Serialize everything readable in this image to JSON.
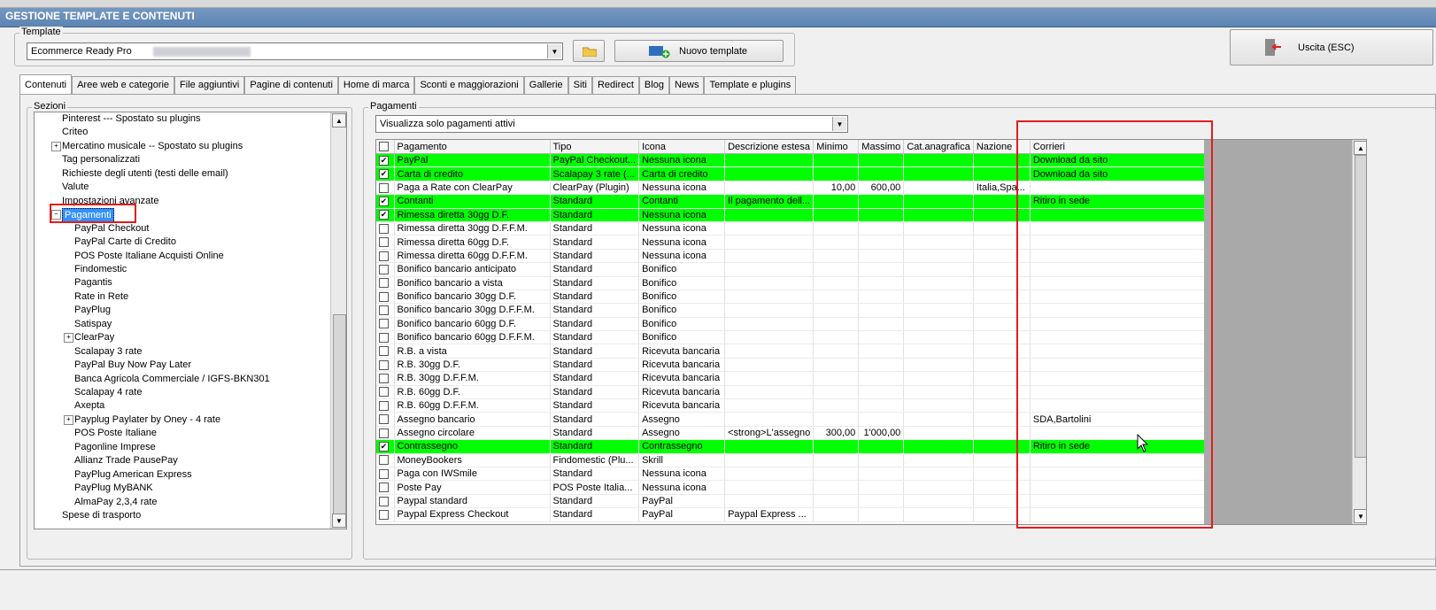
{
  "window": {
    "title": "GESTIONE TEMPLATE E CONTENUTI"
  },
  "template": {
    "group_label": "Template",
    "selected": "Ecommerce Ready Pro",
    "new_template_label": "Nuovo template",
    "exit_label": "Uscita (ESC)"
  },
  "tabs": [
    "Contenuti",
    "Aree web e categorie",
    "File aggiuntivi",
    "Pagine di contenuti",
    "Home di marca",
    "Sconti e maggiorazioni",
    "Gallerie",
    "Siti",
    "Redirect",
    "Blog",
    "News",
    "Template e plugins"
  ],
  "sections": {
    "label": "Sezioni",
    "items": [
      {
        "label": "Pinterest --- Spostato su plugins",
        "level": 0,
        "expander": ""
      },
      {
        "label": "Criteo",
        "level": 0,
        "expander": ""
      },
      {
        "label": "Mercatino musicale -- Spostato su plugins",
        "level": 0,
        "expander": "+"
      },
      {
        "label": "Tag personalizzati",
        "level": 0,
        "expander": ""
      },
      {
        "label": "Richieste degli utenti (testi delle email)",
        "level": 0,
        "expander": ""
      },
      {
        "label": "Valute",
        "level": 0,
        "expander": ""
      },
      {
        "label": "Impostazioni avanzate",
        "level": 0,
        "expander": ""
      },
      {
        "label": "Pagamenti",
        "level": 0,
        "expander": "-",
        "selected": true
      },
      {
        "label": "PayPal Checkout",
        "level": 1,
        "expander": ""
      },
      {
        "label": "PayPal Carte di Credito",
        "level": 1,
        "expander": ""
      },
      {
        "label": "POS Poste Italiane Acquisti Online",
        "level": 1,
        "expander": ""
      },
      {
        "label": "Findomestic",
        "level": 1,
        "expander": ""
      },
      {
        "label": "Pagantis",
        "level": 1,
        "expander": ""
      },
      {
        "label": "Rate in Rete",
        "level": 1,
        "expander": ""
      },
      {
        "label": "PayPlug",
        "level": 1,
        "expander": ""
      },
      {
        "label": "Satispay",
        "level": 1,
        "expander": ""
      },
      {
        "label": "ClearPay",
        "level": 1,
        "expander": "+"
      },
      {
        "label": "Scalapay 3 rate",
        "level": 1,
        "expander": ""
      },
      {
        "label": "PayPal Buy Now Pay Later",
        "level": 1,
        "expander": ""
      },
      {
        "label": "Banca Agricola Commerciale / IGFS-BKN301",
        "level": 1,
        "expander": ""
      },
      {
        "label": "Scalapay 4 rate",
        "level": 1,
        "expander": ""
      },
      {
        "label": "Axepta",
        "level": 1,
        "expander": ""
      },
      {
        "label": "Payplug Paylater by Oney - 4 rate",
        "level": 1,
        "expander": "+"
      },
      {
        "label": "POS Poste Italiane",
        "level": 1,
        "expander": ""
      },
      {
        "label": "Pagonline Imprese",
        "level": 1,
        "expander": ""
      },
      {
        "label": "Allianz Trade PausePay",
        "level": 1,
        "expander": ""
      },
      {
        "label": "PayPlug American Express",
        "level": 1,
        "expander": ""
      },
      {
        "label": "PayPlug MyBANK",
        "level": 1,
        "expander": ""
      },
      {
        "label": "AlmaPay 2,3,4 rate",
        "level": 1,
        "expander": ""
      },
      {
        "label": "Spese di trasporto",
        "level": 0,
        "expander": ""
      }
    ]
  },
  "payments": {
    "label": "Pagamenti",
    "filter": "Visualizza solo pagamenti attivi",
    "columns": [
      "Pagamento",
      "Tipo",
      "Icona",
      "Descrizione estesa",
      "Minimo",
      "Massimo",
      "Cat.anagrafica",
      "Nazione",
      "Corrieri"
    ],
    "rows": [
      {
        "checked": true,
        "green": true,
        "cells": [
          "PayPal",
          "PayPal Checkout...",
          "Nessuna icona",
          "",
          "",
          "",
          "",
          "",
          "Download da sito"
        ]
      },
      {
        "checked": true,
        "green": true,
        "cells": [
          "Carta di credito",
          "Scalapay 3 rate (...",
          "Carta di credito",
          "",
          "",
          "",
          "",
          "",
          "Download da sito"
        ]
      },
      {
        "checked": false,
        "green": false,
        "cells": [
          "Paga a Rate con ClearPay",
          "ClearPay (Plugin)",
          "Nessuna icona",
          "",
          "10,00",
          "600,00",
          "",
          "Italia,Spa...",
          ""
        ]
      },
      {
        "checked": true,
        "green": true,
        "cells": [
          "Contanti",
          "Standard",
          "Contanti",
          "Il pagamento dell...",
          "",
          "",
          "",
          "",
          "Ritiro in sede"
        ]
      },
      {
        "checked": true,
        "green": true,
        "cells": [
          "Rimessa diretta 30gg D.F.",
          "Standard",
          "Nessuna icona",
          "",
          "",
          "",
          "",
          "",
          ""
        ]
      },
      {
        "checked": false,
        "green": false,
        "cells": [
          "Rimessa diretta 30gg D.F.F.M.",
          "Standard",
          "Nessuna icona",
          "",
          "",
          "",
          "",
          "",
          ""
        ]
      },
      {
        "checked": false,
        "green": false,
        "cells": [
          "Rimessa diretta 60gg D.F.",
          "Standard",
          "Nessuna icona",
          "",
          "",
          "",
          "",
          "",
          ""
        ]
      },
      {
        "checked": false,
        "green": false,
        "cells": [
          "Rimessa diretta 60gg D.F.F.M.",
          "Standard",
          "Nessuna icona",
          "",
          "",
          "",
          "",
          "",
          ""
        ]
      },
      {
        "checked": false,
        "green": false,
        "cells": [
          "Bonifico bancario anticipato",
          "Standard",
          "Bonifico",
          "",
          "",
          "",
          "",
          "",
          ""
        ]
      },
      {
        "checked": false,
        "green": false,
        "cells": [
          "Bonifico bancario a vista",
          "Standard",
          "Bonifico",
          "",
          "",
          "",
          "",
          "",
          ""
        ]
      },
      {
        "checked": false,
        "green": false,
        "cells": [
          "Bonifico bancario 30gg D.F.",
          "Standard",
          "Bonifico",
          "",
          "",
          "",
          "",
          "",
          ""
        ]
      },
      {
        "checked": false,
        "green": false,
        "cells": [
          "Bonifico bancario 30gg D.F.F.M.",
          "Standard",
          "Bonifico",
          "",
          "",
          "",
          "",
          "",
          ""
        ]
      },
      {
        "checked": false,
        "green": false,
        "cells": [
          "Bonifico bancario 60gg D.F.",
          "Standard",
          "Bonifico",
          "",
          "",
          "",
          "",
          "",
          ""
        ]
      },
      {
        "checked": false,
        "green": false,
        "cells": [
          "Bonifico bancario 60gg D.F.F.M.",
          "Standard",
          "Bonifico",
          "",
          "",
          "",
          "",
          "",
          ""
        ]
      },
      {
        "checked": false,
        "green": false,
        "cells": [
          "R.B. a vista",
          "Standard",
          "Ricevuta bancaria",
          "",
          "",
          "",
          "",
          "",
          ""
        ]
      },
      {
        "checked": false,
        "green": false,
        "cells": [
          "R.B. 30gg D.F.",
          "Standard",
          "Ricevuta bancaria",
          "",
          "",
          "",
          "",
          "",
          ""
        ]
      },
      {
        "checked": false,
        "green": false,
        "cells": [
          "R.B. 30gg D.F.F.M.",
          "Standard",
          "Ricevuta bancaria",
          "",
          "",
          "",
          "",
          "",
          ""
        ]
      },
      {
        "checked": false,
        "green": false,
        "cells": [
          "R.B. 60gg D.F.",
          "Standard",
          "Ricevuta bancaria",
          "",
          "",
          "",
          "",
          "",
          ""
        ]
      },
      {
        "checked": false,
        "green": false,
        "cells": [
          "R.B. 60gg D.F.F.M.",
          "Standard",
          "Ricevuta bancaria",
          "",
          "",
          "",
          "",
          "",
          ""
        ]
      },
      {
        "checked": false,
        "green": false,
        "cells": [
          "Assegno bancario",
          "Standard",
          "Assegno",
          "",
          "",
          "",
          "",
          "",
          "SDA,Bartolini"
        ]
      },
      {
        "checked": false,
        "green": false,
        "cells": [
          "Assegno circolare",
          "Standard",
          "Assegno",
          "<strong>L'assegno",
          "300,00",
          "1'000,00",
          "",
          "",
          ""
        ]
      },
      {
        "checked": true,
        "green": true,
        "cells": [
          "Contrassegno",
          "Standard",
          "Contrassegno",
          "",
          "",
          "",
          "",
          "",
          "Ritiro in sede"
        ]
      },
      {
        "checked": false,
        "green": false,
        "cells": [
          "MoneyBookers",
          "Findomestic (Plu...",
          "Skrill",
          "",
          "",
          "",
          "",
          "",
          ""
        ]
      },
      {
        "checked": false,
        "green": false,
        "cells": [
          "Paga con IWSmile",
          "Standard",
          "Nessuna icona",
          "",
          "",
          "",
          "",
          "",
          ""
        ]
      },
      {
        "checked": false,
        "green": false,
        "cells": [
          "Poste Pay",
          "POS Poste Italia...",
          "Nessuna icona",
          "",
          "",
          "",
          "",
          "",
          ""
        ]
      },
      {
        "checked": false,
        "green": false,
        "cells": [
          "Paypal standard",
          "Standard",
          "PayPal",
          "",
          "",
          "",
          "",
          "",
          ""
        ]
      },
      {
        "checked": false,
        "green": false,
        "cells": [
          "Paypal Express Checkout",
          "Standard",
          "PayPal",
          "Paypal Express ...",
          "",
          "",
          "",
          "",
          ""
        ]
      }
    ]
  },
  "colors": {
    "active_row": "#00ff00",
    "highlight_box": "#e31c1c",
    "selection": "#3390ff"
  }
}
